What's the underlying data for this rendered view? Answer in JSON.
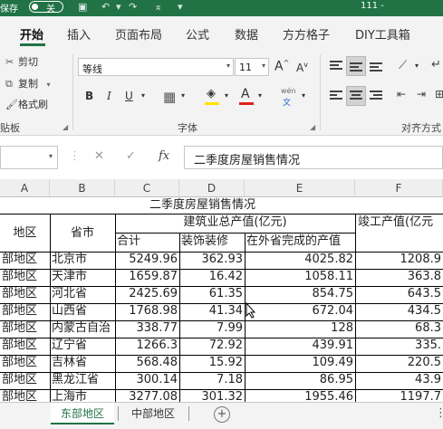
{
  "titlebar": {
    "autosave_label": "保存",
    "autosave_state": "关",
    "doc_title": "111 -"
  },
  "ribbon_tabs": [
    "开始",
    "插入",
    "页面布局",
    "公式",
    "数据",
    "方方格子",
    "DIY工具箱"
  ],
  "active_tab": "开始",
  "clipboard": {
    "cut": "剪切",
    "copy": "复制",
    "format_painter": "格式刷",
    "group_label": "贴板"
  },
  "font": {
    "name": "等线",
    "size": "11",
    "group_label": "字体",
    "bold": "B",
    "italic": "I",
    "underline": "U",
    "grow": "A",
    "shrink": "A",
    "font_color": "A",
    "phonetic": "wén"
  },
  "alignment": {
    "group_label": "对齐方式"
  },
  "formula_bar": {
    "cancel": "✕",
    "enter": "✓",
    "fx": "fx",
    "content": "二季度房屋销售情况"
  },
  "columns": [
    "A",
    "B",
    "C",
    "D",
    "E",
    "F"
  ],
  "table": {
    "title": "二季度房屋销售情况",
    "header_region": "地区",
    "header_province": "省市",
    "header_construction": "建筑业总产值(亿元)",
    "header_completed": "竣工产值(亿元",
    "header_total": "合计",
    "header_decoration": "装饰装修",
    "header_outside": "在外省完成的产值",
    "rows": [
      {
        "region": "部地区",
        "province": "北京市",
        "total": "5249.96",
        "decoration": "362.93",
        "outside": "4025.82",
        "completed": "1208.9"
      },
      {
        "region": "部地区",
        "province": "天津市",
        "total": "1659.87",
        "decoration": "16.42",
        "outside": "1058.11",
        "completed": "363.8"
      },
      {
        "region": "部地区",
        "province": "河北省",
        "total": "2425.69",
        "decoration": "61.35",
        "outside": "854.75",
        "completed": "643.5"
      },
      {
        "region": "部地区",
        "province": "山西省",
        "total": "1768.98",
        "decoration": "41.34",
        "outside": "672.04",
        "completed": "434.5"
      },
      {
        "region": "部地区",
        "province": "内蒙古自治",
        "total": "338.77",
        "decoration": "7.99",
        "outside": "128",
        "completed": "68.3"
      },
      {
        "region": "部地区",
        "province": "辽宁省",
        "total": "1266.3",
        "decoration": "72.92",
        "outside": "439.91",
        "completed": "335."
      },
      {
        "region": "部地区",
        "province": "吉林省",
        "total": "568.48",
        "decoration": "15.92",
        "outside": "109.49",
        "completed": "220.5"
      },
      {
        "region": "部地区",
        "province": "黑龙江省",
        "total": "300.14",
        "decoration": "7.18",
        "outside": "86.95",
        "completed": "43.9"
      },
      {
        "region": "部地区",
        "province": "上海市",
        "total": "3277.08",
        "decoration": "301.32",
        "outside": "1955.46",
        "completed": "1197.7"
      }
    ]
  },
  "sheet_tabs": [
    "东部地区",
    "中部地区"
  ],
  "active_sheet": "东部地区",
  "colors": {
    "accent": "#217346",
    "grid_line": "#000000"
  }
}
